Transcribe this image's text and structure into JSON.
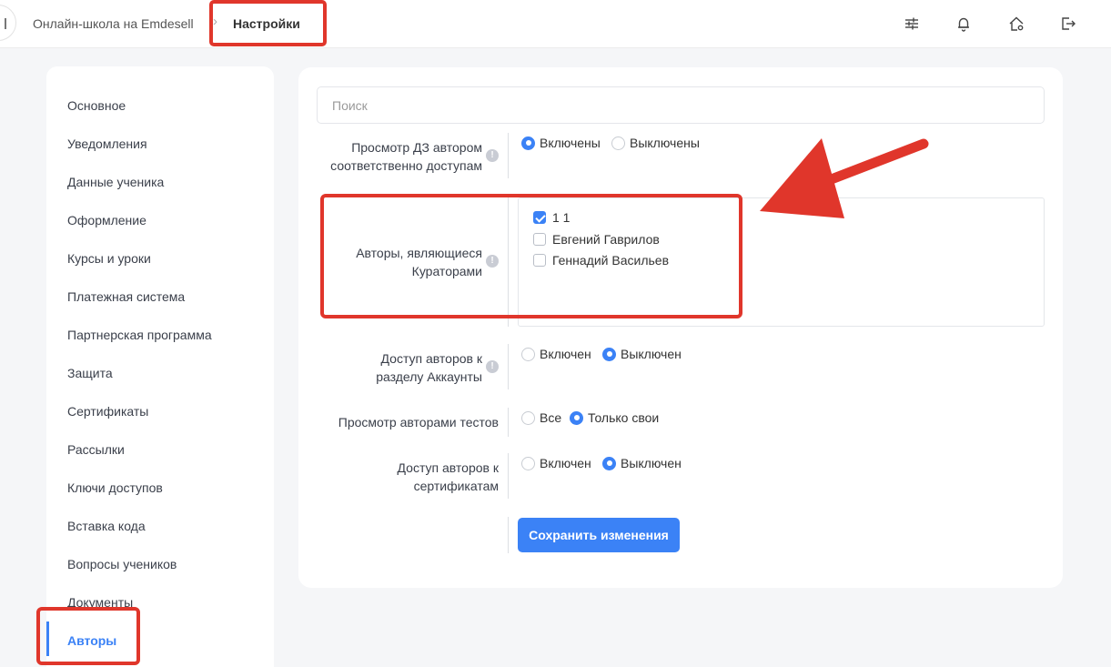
{
  "header": {
    "breadcrumb_root": "Онлайн-школа на Emdesell",
    "breadcrumb_separator": "›",
    "breadcrumb_current": "Настройки",
    "icons": [
      "settings-sliders-icon",
      "bell-icon",
      "home-settings-icon",
      "logout-icon"
    ]
  },
  "sidebar": {
    "items": [
      {
        "label": "Основное"
      },
      {
        "label": "Уведомления"
      },
      {
        "label": "Данные ученика"
      },
      {
        "label": "Оформление"
      },
      {
        "label": "Курсы и уроки"
      },
      {
        "label": "Платежная система"
      },
      {
        "label": "Партнерская программа"
      },
      {
        "label": "Защита"
      },
      {
        "label": "Сертификаты"
      },
      {
        "label": "Рассылки"
      },
      {
        "label": "Ключи доступов"
      },
      {
        "label": "Вставка кода"
      },
      {
        "label": "Вопросы учеников"
      },
      {
        "label": "Документы"
      },
      {
        "label": "Авторы",
        "active": true
      }
    ]
  },
  "main": {
    "search_placeholder": "Поиск",
    "settings": {
      "hw_view": {
        "label_line1": "Просмотр ДЗ автором",
        "label_line2": "соответственно доступам",
        "options": [
          "Включены",
          "Выключены"
        ],
        "selected": "Включены"
      },
      "curators": {
        "label_line1": "Авторы, являющиеся",
        "label_line2": "Кураторами",
        "authors": [
          {
            "name": "1 1",
            "checked": true
          },
          {
            "name": "Евгений Гаврилов",
            "checked": false
          },
          {
            "name": "Геннадий Васильев",
            "checked": false
          }
        ]
      },
      "accounts_access": {
        "label_line1": "Доступ авторов к",
        "label_line2": "разделу Аккаунты",
        "options": [
          "Включен",
          "Выключен"
        ],
        "selected": "Выключен"
      },
      "tests_view": {
        "label": "Просмотр авторами тестов",
        "options": [
          "Все",
          "Только свои"
        ],
        "selected": "Только свои"
      },
      "certificates_access": {
        "label_line1": "Доступ авторов к",
        "label_line2": "сертификатам",
        "options": [
          "Включен",
          "Выключен"
        ],
        "selected": "Выключен"
      }
    },
    "info_glyph": "!",
    "save_label": "Сохранить изменения"
  },
  "colors": {
    "accent": "#3b82f6",
    "highlight": "#e0362b"
  }
}
